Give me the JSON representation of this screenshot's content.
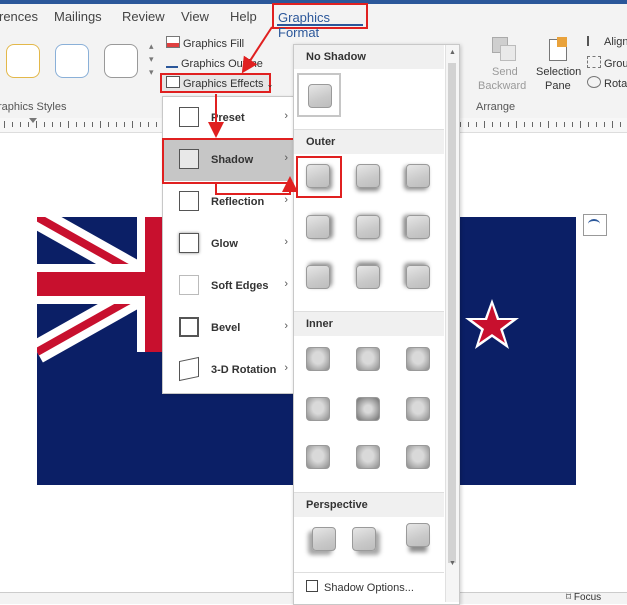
{
  "tabs": [
    "rences",
    "Mailings",
    "Review",
    "View",
    "Help"
  ],
  "active_tab": "Graphics Format",
  "ribbon": {
    "graphics_fill": "Graphics Fill",
    "graphics_outline": "Graphics Outline",
    "graphics_effects": "Graphics Effects",
    "graphics_styles_label": "raphics Styles",
    "send_backward": "Send",
    "send_backward2": "Backward",
    "selection_pane": "Selection",
    "selection_pane2": "Pane",
    "arrange_label": "Arrange",
    "align": "Align",
    "group": "Group",
    "rotate": "Rotate"
  },
  "effects_menu": {
    "items": [
      "Preset",
      "Shadow",
      "Reflection",
      "Glow",
      "Soft Edges",
      "Bevel",
      "3-D Rotation"
    ]
  },
  "shadow_gallery": {
    "sections": [
      "No Shadow",
      "Outer",
      "Inner",
      "Perspective"
    ],
    "options_label": "Shadow Options..."
  },
  "status": {
    "focus": "Focus"
  },
  "colors": {
    "accent": "#2b579a",
    "highlight": "#e02020",
    "flag_blue": "#0b1f66",
    "flag_red": "#c8102e"
  }
}
